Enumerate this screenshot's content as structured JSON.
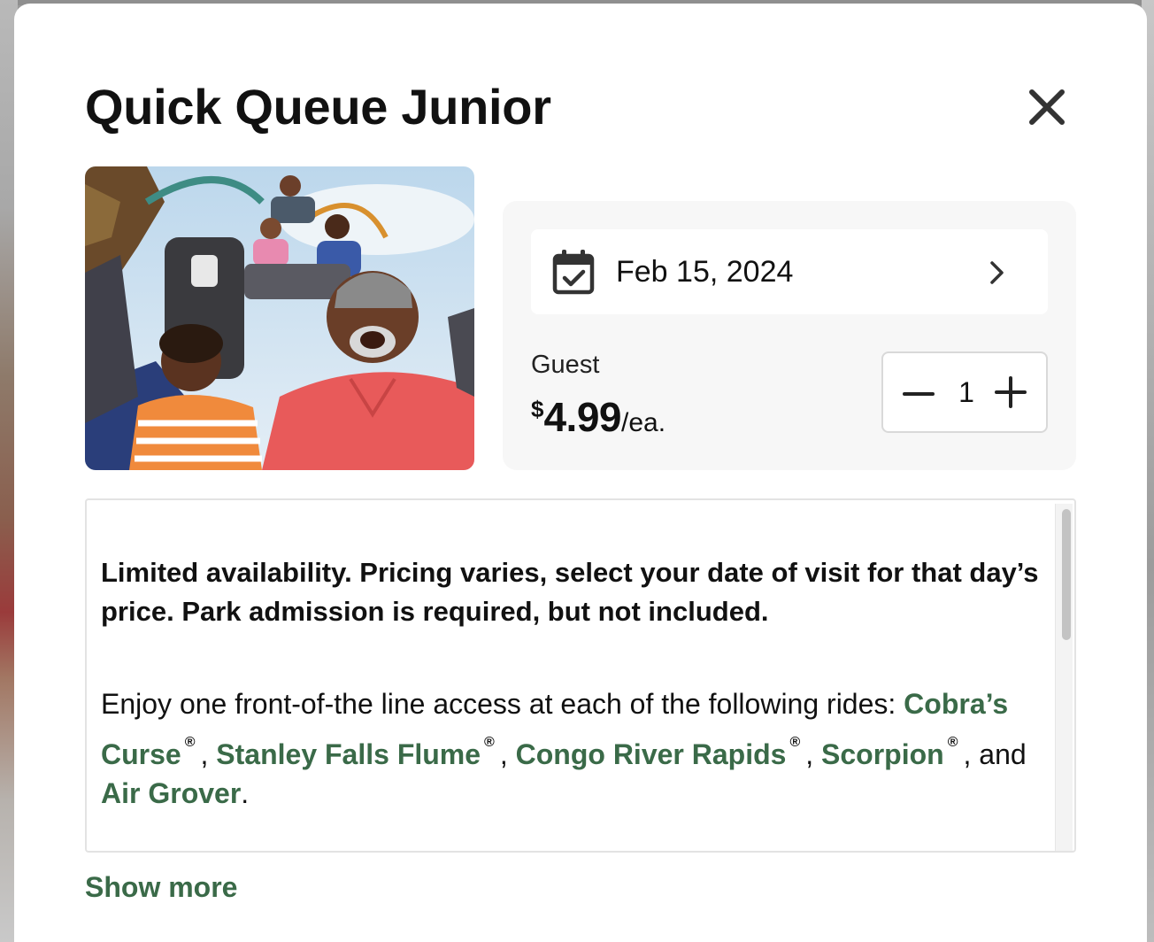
{
  "modal": {
    "title": "Quick Queue Junior",
    "close_icon": "close-icon"
  },
  "hero_image": {
    "subject": "family-on-roller-coaster-photo"
  },
  "booking": {
    "date_icon": "calendar-check-icon",
    "date": "Feb 15, 2024",
    "chevron_icon": "chevron-right-icon",
    "guest_label": "Guest",
    "price_currency": "$",
    "price_amount": "4.99",
    "price_unit": "/ea.",
    "quantity": "1",
    "decrement_icon": "minus-icon",
    "increment_icon": "plus-icon"
  },
  "description": {
    "notice": "Limited availability. Pricing varies, select your date of visit for that day’s price. Park admission is required, but not included.",
    "intro": "Enjoy one front-of-the line access at each of the following rides:",
    "rides": [
      {
        "name": "Cobra’s Curse",
        "mark": "®",
        "after": ","
      },
      {
        "name": "Stanley Falls Flume",
        "mark": "®",
        "after": ","
      },
      {
        "name": "Congo River Rapids",
        "mark": "®",
        "after": ","
      },
      {
        "name": "Scorpion",
        "mark": "®",
        "after": ", and"
      },
      {
        "name": "Air Grover",
        "mark": "",
        "after": "."
      }
    ]
  },
  "show_more_label": "Show more",
  "colors": {
    "accent_green": "#3a6a48",
    "panel_bg": "#f7f7f7",
    "text": "#111111"
  }
}
